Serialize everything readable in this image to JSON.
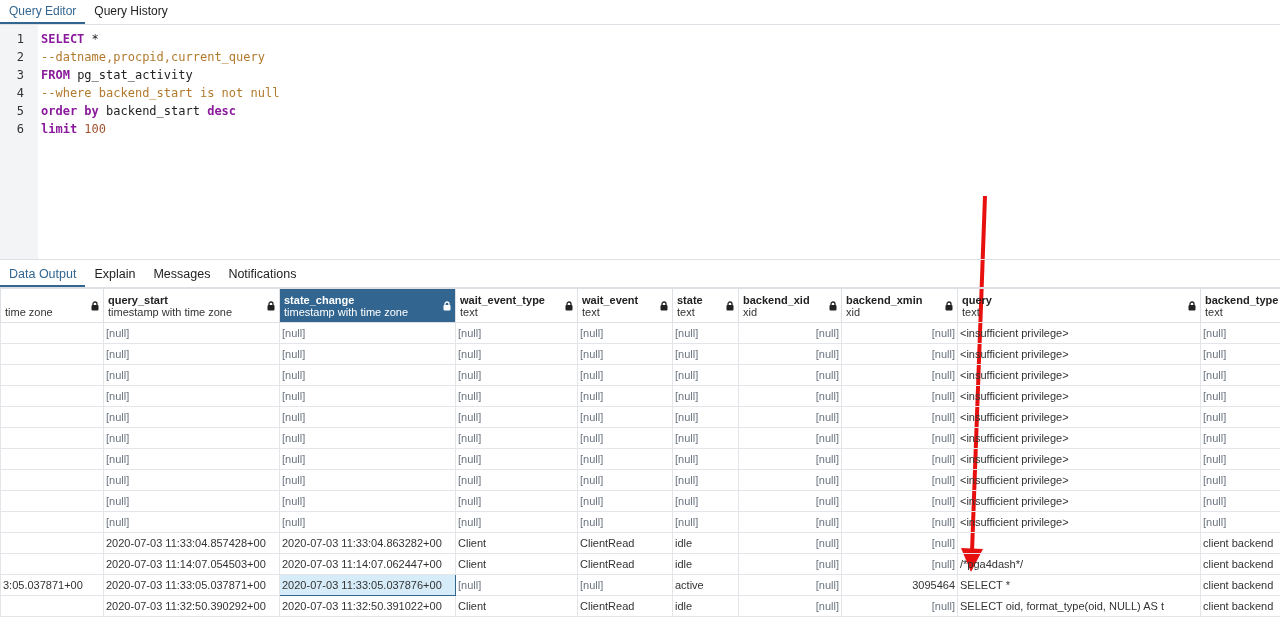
{
  "editor_tabs": [
    {
      "label": "Query Editor",
      "selected": true
    },
    {
      "label": "Query History",
      "selected": false
    }
  ],
  "code_lines": [
    {
      "number": "1",
      "tokens": [
        {
          "kind": "keyword",
          "text": "SELECT"
        },
        {
          "kind": "plain",
          "text": " *"
        }
      ]
    },
    {
      "number": "2",
      "tokens": [
        {
          "kind": "comment",
          "text": "--datname,procpid,current_query"
        }
      ]
    },
    {
      "number": "3",
      "tokens": [
        {
          "kind": "keyword",
          "text": "FROM"
        },
        {
          "kind": "plain",
          "text": " pg_stat_activity"
        }
      ]
    },
    {
      "number": "4",
      "tokens": [
        {
          "kind": "comment",
          "text": "--where backend_start is not null"
        }
      ]
    },
    {
      "number": "5",
      "tokens": [
        {
          "kind": "keyword",
          "text": "order by"
        },
        {
          "kind": "plain",
          "text": " backend_start "
        },
        {
          "kind": "keyword",
          "text": "desc"
        }
      ]
    },
    {
      "number": "6",
      "tokens": [
        {
          "kind": "keyword",
          "text": "limit"
        },
        {
          "kind": "number",
          "text": " 100"
        }
      ]
    }
  ],
  "result_tabs": [
    {
      "label": "Data Output",
      "selected": true
    },
    {
      "label": "Explain",
      "selected": false
    },
    {
      "label": "Messages",
      "selected": false
    },
    {
      "label": "Notifications",
      "selected": false
    }
  ],
  "table": {
    "columns": [
      {
        "type": "time zone",
        "selected": false,
        "right_aligned": false
      },
      {
        "name": "query_start",
        "type": "timestamp with time zone",
        "selected": false,
        "right_aligned": false
      },
      {
        "name": "state_change",
        "type": "timestamp with time zone",
        "selected": true,
        "right_aligned": false
      },
      {
        "name": "wait_event_type",
        "type": "text",
        "selected": false,
        "right_aligned": false
      },
      {
        "name": "wait_event",
        "type": "text",
        "selected": false,
        "right_aligned": false
      },
      {
        "name": "state",
        "type": "text",
        "selected": false,
        "right_aligned": false
      },
      {
        "name": "backend_xid",
        "type": "xid",
        "selected": false,
        "right_aligned": true
      },
      {
        "name": "backend_xmin",
        "type": "xid",
        "selected": false,
        "right_aligned": true
      },
      {
        "name": "query",
        "type": "text",
        "selected": false,
        "right_aligned": false
      },
      {
        "name": "backend_type",
        "type": "text",
        "selected": false,
        "right_aligned": false
      }
    ],
    "rows": [
      {
        "selected": false,
        "cells": [
          null,
          {
            "text": "[null]",
            "is_null": true
          },
          {
            "text": "[null]",
            "is_null": true
          },
          {
            "text": "[null]",
            "is_null": true
          },
          {
            "text": "[null]",
            "is_null": true
          },
          {
            "text": "[null]",
            "is_null": true
          },
          {
            "text": "[null]",
            "is_null": true
          },
          {
            "text": "[null]",
            "is_null": true
          },
          "<insufficient privilege>",
          {
            "text": "[null]",
            "is_null": true
          }
        ]
      },
      {
        "selected": false,
        "cells": [
          null,
          {
            "text": "[null]",
            "is_null": true
          },
          {
            "text": "[null]",
            "is_null": true
          },
          {
            "text": "[null]",
            "is_null": true
          },
          {
            "text": "[null]",
            "is_null": true
          },
          {
            "text": "[null]",
            "is_null": true
          },
          {
            "text": "[null]",
            "is_null": true
          },
          {
            "text": "[null]",
            "is_null": true
          },
          "<insufficient privilege>",
          {
            "text": "[null]",
            "is_null": true
          }
        ]
      },
      {
        "selected": false,
        "cells": [
          null,
          {
            "text": "[null]",
            "is_null": true
          },
          {
            "text": "[null]",
            "is_null": true
          },
          {
            "text": "[null]",
            "is_null": true
          },
          {
            "text": "[null]",
            "is_null": true
          },
          {
            "text": "[null]",
            "is_null": true
          },
          {
            "text": "[null]",
            "is_null": true
          },
          {
            "text": "[null]",
            "is_null": true
          },
          "<insufficient privilege>",
          {
            "text": "[null]",
            "is_null": true
          }
        ]
      },
      {
        "selected": false,
        "cells": [
          null,
          {
            "text": "[null]",
            "is_null": true
          },
          {
            "text": "[null]",
            "is_null": true
          },
          {
            "text": "[null]",
            "is_null": true
          },
          {
            "text": "[null]",
            "is_null": true
          },
          {
            "text": "[null]",
            "is_null": true
          },
          {
            "text": "[null]",
            "is_null": true
          },
          {
            "text": "[null]",
            "is_null": true
          },
          "<insufficient privilege>",
          {
            "text": "[null]",
            "is_null": true
          }
        ]
      },
      {
        "selected": false,
        "cells": [
          null,
          {
            "text": "[null]",
            "is_null": true
          },
          {
            "text": "[null]",
            "is_null": true
          },
          {
            "text": "[null]",
            "is_null": true
          },
          {
            "text": "[null]",
            "is_null": true
          },
          {
            "text": "[null]",
            "is_null": true
          },
          {
            "text": "[null]",
            "is_null": true
          },
          {
            "text": "[null]",
            "is_null": true
          },
          "<insufficient privilege>",
          {
            "text": "[null]",
            "is_null": true
          }
        ]
      },
      {
        "selected": false,
        "cells": [
          null,
          {
            "text": "[null]",
            "is_null": true
          },
          {
            "text": "[null]",
            "is_null": true
          },
          {
            "text": "[null]",
            "is_null": true
          },
          {
            "text": "[null]",
            "is_null": true
          },
          {
            "text": "[null]",
            "is_null": true
          },
          {
            "text": "[null]",
            "is_null": true
          },
          {
            "text": "[null]",
            "is_null": true
          },
          "<insufficient privilege>",
          {
            "text": "[null]",
            "is_null": true
          }
        ]
      },
      {
        "selected": false,
        "cells": [
          null,
          {
            "text": "[null]",
            "is_null": true
          },
          {
            "text": "[null]",
            "is_null": true
          },
          {
            "text": "[null]",
            "is_null": true
          },
          {
            "text": "[null]",
            "is_null": true
          },
          {
            "text": "[null]",
            "is_null": true
          },
          {
            "text": "[null]",
            "is_null": true
          },
          {
            "text": "[null]",
            "is_null": true
          },
          "<insufficient privilege>",
          {
            "text": "[null]",
            "is_null": true
          }
        ]
      },
      {
        "selected": false,
        "cells": [
          null,
          {
            "text": "[null]",
            "is_null": true
          },
          {
            "text": "[null]",
            "is_null": true
          },
          {
            "text": "[null]",
            "is_null": true
          },
          {
            "text": "[null]",
            "is_null": true
          },
          {
            "text": "[null]",
            "is_null": true
          },
          {
            "text": "[null]",
            "is_null": true
          },
          {
            "text": "[null]",
            "is_null": true
          },
          "<insufficient privilege>",
          {
            "text": "[null]",
            "is_null": true
          }
        ]
      },
      {
        "selected": false,
        "cells": [
          null,
          {
            "text": "[null]",
            "is_null": true
          },
          {
            "text": "[null]",
            "is_null": true
          },
          {
            "text": "[null]",
            "is_null": true
          },
          {
            "text": "[null]",
            "is_null": true
          },
          {
            "text": "[null]",
            "is_null": true
          },
          {
            "text": "[null]",
            "is_null": true
          },
          {
            "text": "[null]",
            "is_null": true
          },
          "<insufficient privilege>",
          {
            "text": "[null]",
            "is_null": true
          }
        ]
      },
      {
        "selected": false,
        "cells": [
          null,
          {
            "text": "[null]",
            "is_null": true
          },
          {
            "text": "[null]",
            "is_null": true
          },
          {
            "text": "[null]",
            "is_null": true
          },
          {
            "text": "[null]",
            "is_null": true
          },
          {
            "text": "[null]",
            "is_null": true
          },
          {
            "text": "[null]",
            "is_null": true
          },
          {
            "text": "[null]",
            "is_null": true
          },
          "<insufficient privilege>",
          {
            "text": "[null]",
            "is_null": true
          }
        ]
      },
      {
        "selected": false,
        "cells": [
          null,
          "2020-07-03 11:33:04.857428+00",
          "2020-07-03 11:33:04.863282+00",
          "Client",
          "ClientRead",
          "idle",
          {
            "text": "[null]",
            "is_null": true
          },
          {
            "text": "[null]",
            "is_null": true
          },
          null,
          "client backend"
        ]
      },
      {
        "selected": false,
        "cells": [
          null,
          "2020-07-03 11:14:07.054503+00",
          "2020-07-03 11:14:07.062447+00",
          "Client",
          "ClientRead",
          "idle",
          {
            "text": "[null]",
            "is_null": true
          },
          {
            "text": "[null]",
            "is_null": true
          },
          "/*pga4dash*/",
          "client backend"
        ]
      },
      {
        "selected": true,
        "cells": [
          "3:05.037871+00",
          "2020-07-03 11:33:05.037871+00",
          "2020-07-03 11:33:05.037876+00",
          {
            "text": "[null]",
            "is_null": true
          },
          {
            "text": "[null]",
            "is_null": true
          },
          "active",
          {
            "text": "[null]",
            "is_null": true
          },
          "3095464",
          "SELECT *",
          "client backend"
        ]
      },
      {
        "selected": false,
        "cells": [
          null,
          "2020-07-03 11:32:50.390292+00",
          "2020-07-03 11:32:50.391022+00",
          "Client",
          "ClientRead",
          "idle",
          {
            "text": "[null]",
            "is_null": true
          },
          {
            "text": "[null]",
            "is_null": true
          },
          "SELECT oid, format_type(oid, NULL) AS t",
          "client backend"
        ]
      }
    ]
  }
}
